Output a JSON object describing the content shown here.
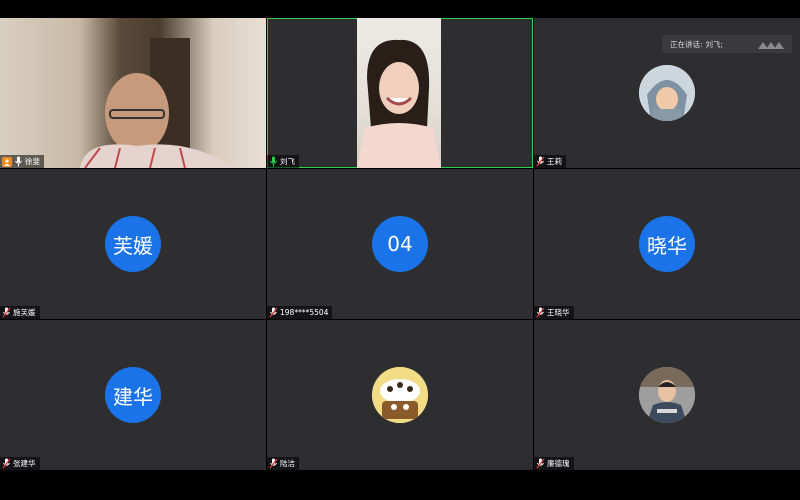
{
  "speaking_indicator": {
    "prefix": "正在讲话:",
    "name": "刘飞;"
  },
  "participants": [
    {
      "name": "徐斐",
      "type": "video",
      "host": true
    },
    {
      "name": "刘飞",
      "type": "video",
      "active": true
    },
    {
      "name": "王莉",
      "type": "avatar-image"
    },
    {
      "name": "施芙媛",
      "type": "initials",
      "initials": "芙媛"
    },
    {
      "name": "198****5504",
      "type": "initials",
      "initials": "04"
    },
    {
      "name": "王晓华",
      "type": "initials",
      "initials": "晓华"
    },
    {
      "name": "张建华",
      "type": "initials",
      "initials": "建华"
    },
    {
      "name": "陆洁",
      "type": "avatar-image"
    },
    {
      "name": "廉德瑰",
      "type": "avatar-image"
    }
  ],
  "colors": {
    "tile_bg": "#2e2e31",
    "avatar_blue": "#1a73e8",
    "active_border": "#2fd04a",
    "host_badge": "#f28b22"
  }
}
